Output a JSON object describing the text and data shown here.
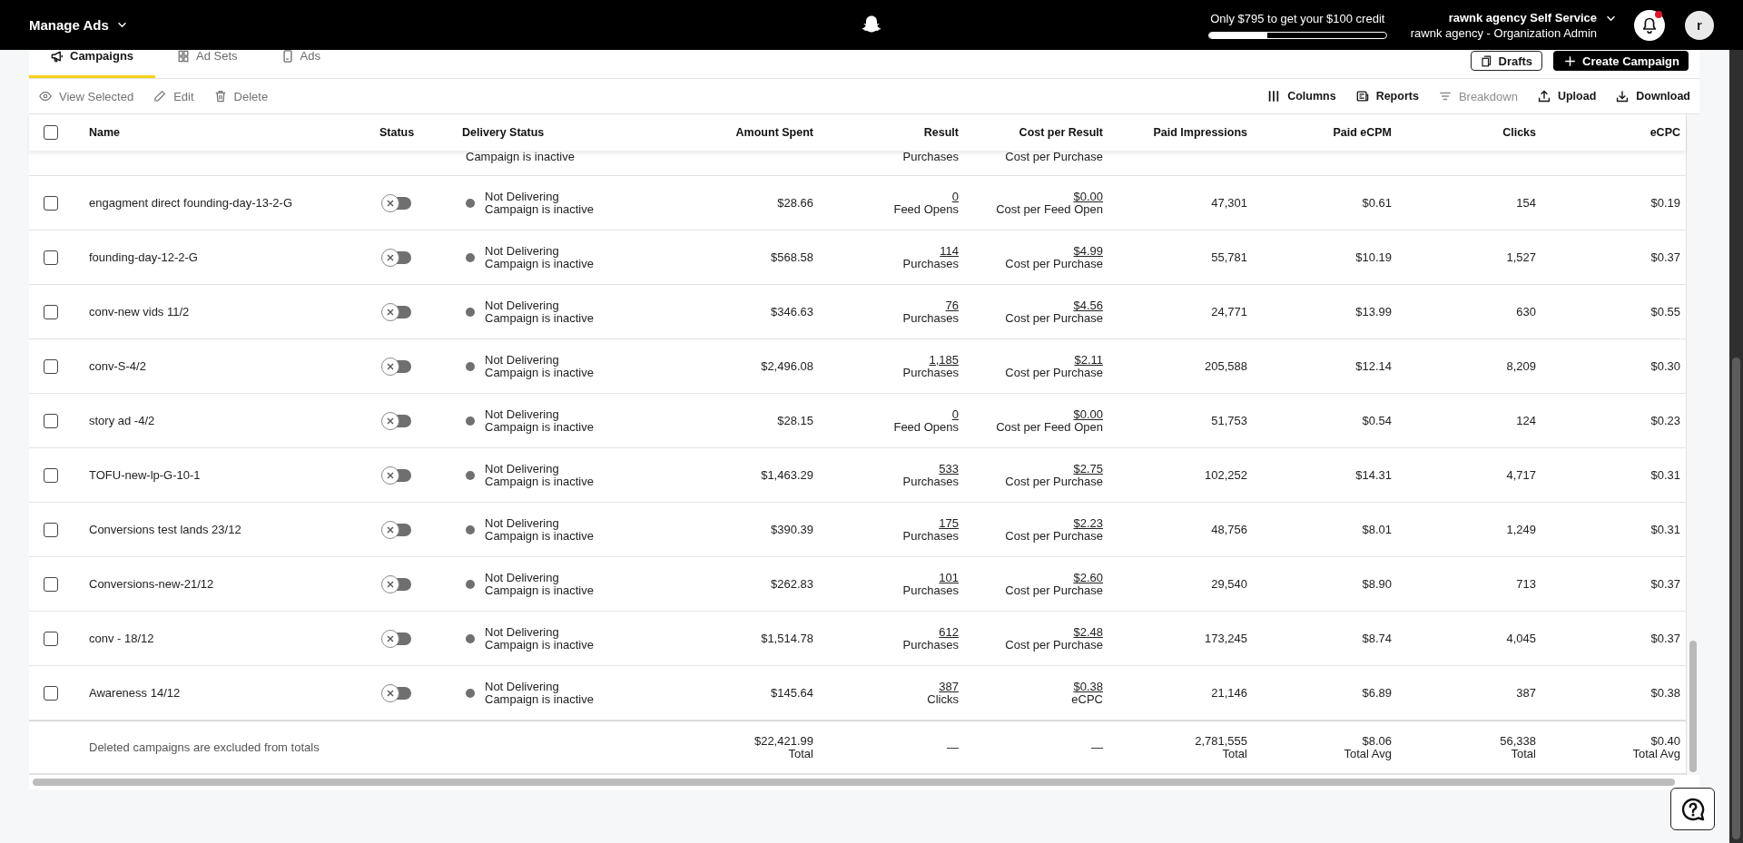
{
  "top_bar": {
    "title": "Manage Ads",
    "credit": {
      "text": "Only $795 to get your $100 credit",
      "level": 0.33
    },
    "account": {
      "name": "rawnk agency Self Service",
      "role": "rawnk agency - Organization Admin"
    },
    "notifications": {
      "unread": true
    },
    "avatar": "r"
  },
  "tabs": [
    {
      "label": "Campaigns",
      "selected": true
    },
    {
      "label": "Ad Sets",
      "selected": false
    },
    {
      "label": "Ads",
      "selected": false
    }
  ],
  "actions": [
    {
      "label": "Drafts",
      "kind": "secondary"
    },
    {
      "label": "Create Campaign",
      "kind": "primary"
    }
  ],
  "toolbar": {
    "left": [
      {
        "label": "View Selected",
        "disabled": true
      },
      {
        "label": "Edit",
        "disabled": true
      },
      {
        "label": "Delete",
        "disabled": true
      }
    ],
    "right": [
      {
        "label": "Columns",
        "disabled": false
      },
      {
        "label": "Reports",
        "disabled": false
      },
      {
        "label": "Breakdown",
        "disabled": true
      },
      {
        "label": "Upload",
        "disabled": false
      },
      {
        "label": "Download",
        "disabled": false
      }
    ]
  },
  "table": {
    "select_all": {
      "checked": false
    },
    "columns": [
      "Name",
      "Status",
      "Delivery Status",
      "Amount Spent",
      "Result",
      "Cost per Result",
      "Paid Impressions",
      "Paid eCPM",
      "Clicks",
      "eCPC"
    ],
    "partial_row": {
      "delivery_detail": "Campaign is inactive",
      "result_label": "Purchases",
      "cost_label": "Cost per Purchase"
    },
    "rows": [
      {
        "checked": false,
        "name": "engagment direct founding-day-13-2-G",
        "on": false,
        "delivery": "Not Delivering",
        "delivery_detail": "Campaign is inactive",
        "amount_spent": "$28.66",
        "result": "0",
        "result_label": "Feed Opens",
        "cost": "$0.00",
        "cost_label": "Cost per Feed Open",
        "paid_impressions": "47,301",
        "paid_ecpm": "$0.61",
        "clicks": "154",
        "ecpc": "$0.19"
      },
      {
        "checked": false,
        "name": "founding-day-12-2-G",
        "on": false,
        "delivery": "Not Delivering",
        "delivery_detail": "Campaign is inactive",
        "amount_spent": "$568.58",
        "result": "114",
        "result_label": "Purchases",
        "cost": "$4.99",
        "cost_label": "Cost per Purchase",
        "paid_impressions": "55,781",
        "paid_ecpm": "$10.19",
        "clicks": "1,527",
        "ecpc": "$0.37"
      },
      {
        "checked": false,
        "name": "conv-new vids 11/2",
        "on": false,
        "delivery": "Not Delivering",
        "delivery_detail": "Campaign is inactive",
        "amount_spent": "$346.63",
        "result": "76",
        "result_label": "Purchases",
        "cost": "$4.56",
        "cost_label": "Cost per Purchase",
        "paid_impressions": "24,771",
        "paid_ecpm": "$13.99",
        "clicks": "630",
        "ecpc": "$0.55"
      },
      {
        "checked": false,
        "name": "conv-S-4/2",
        "on": false,
        "delivery": "Not Delivering",
        "delivery_detail": "Campaign is inactive",
        "amount_spent": "$2,496.08",
        "result": "1,185",
        "result_label": "Purchases",
        "cost": "$2.11",
        "cost_label": "Cost per Purchase",
        "paid_impressions": "205,588",
        "paid_ecpm": "$12.14",
        "clicks": "8,209",
        "ecpc": "$0.30"
      },
      {
        "checked": false,
        "name": "story ad -4/2",
        "on": false,
        "delivery": "Not Delivering",
        "delivery_detail": "Campaign is inactive",
        "amount_spent": "$28.15",
        "result": "0",
        "result_label": "Feed Opens",
        "cost": "$0.00",
        "cost_label": "Cost per Feed Open",
        "paid_impressions": "51,753",
        "paid_ecpm": "$0.54",
        "clicks": "124",
        "ecpc": "$0.23"
      },
      {
        "checked": false,
        "name": "TOFU-new-lp-G-10-1",
        "on": false,
        "delivery": "Not Delivering",
        "delivery_detail": "Campaign is inactive",
        "amount_spent": "$1,463.29",
        "result": "533",
        "result_label": "Purchases",
        "cost": "$2.75",
        "cost_label": "Cost per Purchase",
        "paid_impressions": "102,252",
        "paid_ecpm": "$14.31",
        "clicks": "4,717",
        "ecpc": "$0.31"
      },
      {
        "checked": false,
        "name": "Conversions test lands 23/12",
        "on": false,
        "delivery": "Not Delivering",
        "delivery_detail": "Campaign is inactive",
        "amount_spent": "$390.39",
        "result": "175",
        "result_label": "Purchases",
        "cost": "$2.23",
        "cost_label": "Cost per Purchase",
        "paid_impressions": "48,756",
        "paid_ecpm": "$8.01",
        "clicks": "1,249",
        "ecpc": "$0.31"
      },
      {
        "checked": false,
        "name": "Conversions-new-21/12",
        "on": false,
        "delivery": "Not Delivering",
        "delivery_detail": "Campaign is inactive",
        "amount_spent": "$262.83",
        "result": "101",
        "result_label": "Purchases",
        "cost": "$2.60",
        "cost_label": "Cost per Purchase",
        "paid_impressions": "29,540",
        "paid_ecpm": "$8.90",
        "clicks": "713",
        "ecpc": "$0.37"
      },
      {
        "checked": false,
        "name": "conv - 18/12",
        "on": false,
        "delivery": "Not Delivering",
        "delivery_detail": "Campaign is inactive",
        "amount_spent": "$1,514.78",
        "result": "612",
        "result_label": "Purchases",
        "cost": "$2.48",
        "cost_label": "Cost per Purchase",
        "paid_impressions": "173,245",
        "paid_ecpm": "$8.74",
        "clicks": "4,045",
        "ecpc": "$0.37"
      },
      {
        "checked": false,
        "name": "Awareness 14/12",
        "on": false,
        "delivery": "Not Delivering",
        "delivery_detail": "Campaign is inactive",
        "amount_spent": "$145.64",
        "result": "387",
        "result_label": "Clicks",
        "cost": "$0.38",
        "cost_label": "eCPC",
        "paid_impressions": "21,146",
        "paid_ecpm": "$6.89",
        "clicks": "387",
        "ecpc": "$0.38"
      }
    ],
    "totals": {
      "note": "Deleted campaigns are excluded from totals",
      "amount_spent": {
        "value": "$22,421.99",
        "label": "Total"
      },
      "result": "—",
      "cost": "—",
      "paid_impressions": {
        "value": "2,781,555",
        "label": "Total"
      },
      "paid_ecpm": {
        "value": "$8.06",
        "label": "Total Avg"
      },
      "clicks": {
        "value": "56,338",
        "label": "Total"
      },
      "ecpc": {
        "value": "$0.40",
        "label": "Total Avg"
      }
    }
  }
}
